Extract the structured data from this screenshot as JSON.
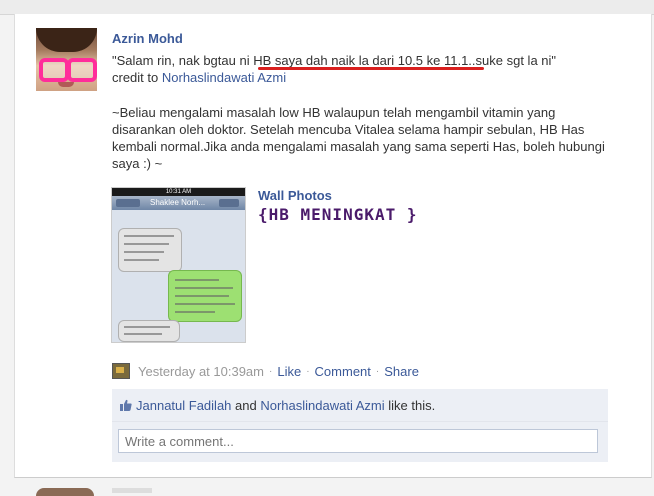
{
  "post": {
    "author": "Azrin Mohd",
    "quote": "\"Salam rin, nak bgtau ni HB saya dah naik la dari 10.5 ke 11.1..suke sgt la ni\"",
    "credit_prefix": "credit to",
    "credit_name": "Norhaslindawati Azmi",
    "body": "~Beliau mengalami masalah low HB walaupun telah mengambil vitamin yang disarankan oleh doktor. Setelah mencuba Vitalea selama hampir sebulan, HB Has kembali normal.Jika anda mengalami masalah yang sama seperti Has, boleh hubungi saya :) ~"
  },
  "attachment": {
    "album": "Wall Photos",
    "title": "{HB MENINGKAT }",
    "phone_time": "10:31 AM",
    "phone_contact": "Shaklee Norh..."
  },
  "meta": {
    "timestamp": "Yesterday at 10:39am",
    "like": "Like",
    "comment": "Comment",
    "share": "Share"
  },
  "likes": {
    "user1": "Jannatul Fadilah",
    "and": "and",
    "user2": "Norhaslindawati Azmi",
    "suffix": "like this."
  },
  "comment_input": {
    "placeholder": "Write a comment..."
  },
  "colors": {
    "link": "#3b5998",
    "underline": "#d9201f",
    "album_title": "#4a1a6a"
  }
}
